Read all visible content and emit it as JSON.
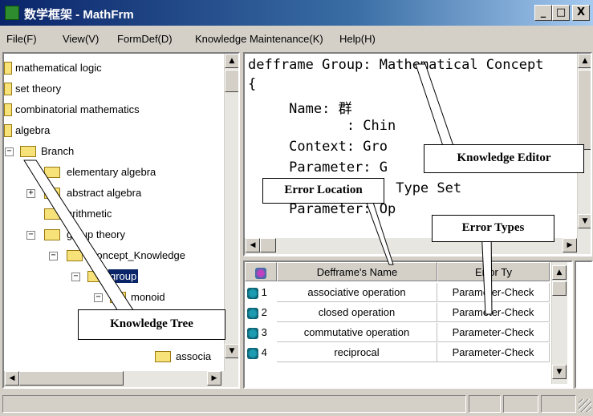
{
  "window": {
    "title": "数学框架 - MathFrm",
    "minimize": "_",
    "maximize": "□",
    "close": "X"
  },
  "menu": [
    "File(F)",
    "View(V)",
    "FormDef(D)",
    "Knowledge Maintenance(K)",
    "Help(H)"
  ],
  "tree": {
    "items": [
      "mathematical logic",
      "set theory",
      "combinatorial mathematics",
      "algebra",
      "Branch",
      "elementary algebra",
      "abstract algebra",
      "arithmetic",
      "group theory",
      "Concept_Knowledge",
      "group",
      "monoid",
      "associa"
    ],
    "selected": "group"
  },
  "editor": {
    "lines": [
      "defframe Group: Mathematical Concept",
      "{",
      "     Name: 群",
      "            : Chin",
      "     Context: Gro",
      "     Parameter: G",
      "                  Type Set",
      "     Parameter: Op"
    ]
  },
  "grid": {
    "columns": [
      "",
      "Defframe's Name",
      "Error Ty"
    ],
    "rows": [
      {
        "n": "1",
        "name": "associative operation",
        "type": "Parameter-Check"
      },
      {
        "n": "2",
        "name": "closed operation",
        "type": "Parameter-Check"
      },
      {
        "n": "3",
        "name": "commutative operation",
        "type": "Parameter-Check"
      },
      {
        "n": "4",
        "name": "reciprocal",
        "type": "Parameter-Check"
      }
    ]
  },
  "callouts": {
    "knowledge_editor": "Knowledge Editor",
    "error_location": "Error Location",
    "error_types": "Error Types",
    "knowledge_tree": "Knowledge Tree"
  },
  "colors": {
    "titlebar": "#0a246a",
    "folder": "#f7e27a",
    "chrome": "#d4d0c8"
  },
  "icons": {
    "app": "app-icon",
    "grid_header": "grid-header-icon",
    "row": "error-row-icon"
  }
}
